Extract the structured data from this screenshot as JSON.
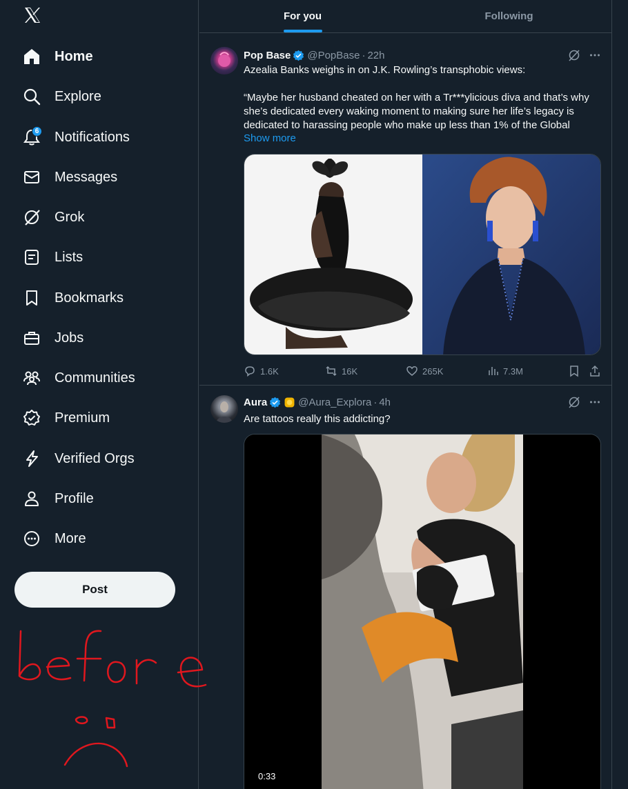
{
  "sidebar": {
    "logo": "x-logo-icon",
    "items": [
      {
        "label": "Home",
        "icon": "home-icon",
        "active": true
      },
      {
        "label": "Explore",
        "icon": "search-icon"
      },
      {
        "label": "Notifications",
        "icon": "bell-icon",
        "badge": "6"
      },
      {
        "label": "Messages",
        "icon": "envelope-icon"
      },
      {
        "label": "Grok",
        "icon": "grok-icon"
      },
      {
        "label": "Lists",
        "icon": "list-icon"
      },
      {
        "label": "Bookmarks",
        "icon": "bookmark-icon"
      },
      {
        "label": "Jobs",
        "icon": "briefcase-icon"
      },
      {
        "label": "Communities",
        "icon": "people-icon"
      },
      {
        "label": "Premium",
        "icon": "premium-icon"
      },
      {
        "label": "Verified Orgs",
        "icon": "lightning-icon"
      },
      {
        "label": "Profile",
        "icon": "person-icon"
      },
      {
        "label": "More",
        "icon": "more-circle-icon"
      }
    ],
    "post_label": "Post",
    "doodle_text": "before"
  },
  "colors": {
    "background": "#15202b",
    "accent": "#1d9bf0",
    "border": "#38444d",
    "muted": "#8b98a5",
    "doodle": "#e0171e"
  },
  "tabs": [
    {
      "label": "For you",
      "active": true
    },
    {
      "label": "Following",
      "active": false
    }
  ],
  "tweets": [
    {
      "display_name": "Pop Base",
      "handle": "@PopBase",
      "time": "22h",
      "text_lines": [
        "Azealia Banks weighs in on J.K. Rowling’s transphobic views:",
        "",
        "“Maybe her husband cheated on her with a Tr***ylicious diva and that’s why",
        "she’s dedicated every waking moment to making sure her life’s legacy is",
        "dedicated to harassing people who make up less than 1% of the Global"
      ],
      "show_more": "Show more",
      "replies": "1.6K",
      "reposts": "16K",
      "likes": "265K",
      "views": "7.3M"
    },
    {
      "display_name": "Aura",
      "handle": "@Aura_Explora",
      "time": "4h",
      "text": "Are tattoos really this addicting?",
      "video_time": "0:33"
    }
  ]
}
